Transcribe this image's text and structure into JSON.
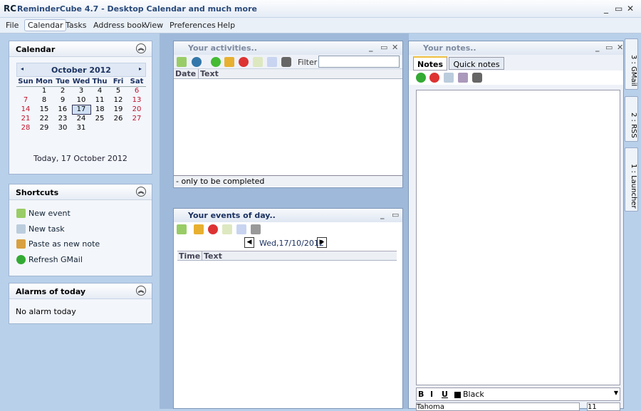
{
  "title": {
    "logo": "RC",
    "text": "ReminderCube 4.7 - Desktop Calendar and much more"
  },
  "menu": [
    "File",
    "Calendar",
    "Tasks",
    "Address book",
    "View",
    "Preferences",
    "Help"
  ],
  "calendar": {
    "title": "Calendar",
    "month": "October 2012",
    "days": [
      "Sun",
      "Mon",
      "Tue",
      "Wed",
      "Thu",
      "Fri",
      "Sat"
    ],
    "weeks": [
      [
        "",
        "1",
        "2",
        "3",
        "4",
        "5",
        "6"
      ],
      [
        "7",
        "8",
        "9",
        "10",
        "11",
        "12",
        "13"
      ],
      [
        "14",
        "15",
        "16",
        "17",
        "18",
        "19",
        "20"
      ],
      [
        "21",
        "22",
        "23",
        "24",
        "25",
        "26",
        "27"
      ],
      [
        "28",
        "29",
        "30",
        "31",
        "",
        "",
        ""
      ]
    ],
    "today_label": "Today, 17 October 2012",
    "today": "17"
  },
  "shortcuts": {
    "title": "Shortcuts",
    "items": [
      "New event",
      "New task",
      "Paste as new note",
      "Refresh GMail"
    ]
  },
  "alarms": {
    "title": "Alarms of today",
    "text": "No alarm today"
  },
  "activities": {
    "title": "Your activities..",
    "filter_label": "Filter",
    "filter_value": "",
    "columns": [
      "Date",
      "Text"
    ],
    "footer": "- only to be completed"
  },
  "events": {
    "title": "Your events of day..",
    "date": "Wed,17/10/2012",
    "columns": [
      "Time",
      "Text"
    ]
  },
  "notes": {
    "title": "Your notes..",
    "tabs": [
      "Notes",
      "Quick notes"
    ],
    "bold": "B",
    "italic": "I",
    "underline": "U",
    "color": "Black",
    "font": "Tahoma",
    "size": "11"
  },
  "side_tabs": [
    "3 : GMail",
    "2 : RSS",
    "1 : Launcher"
  ]
}
